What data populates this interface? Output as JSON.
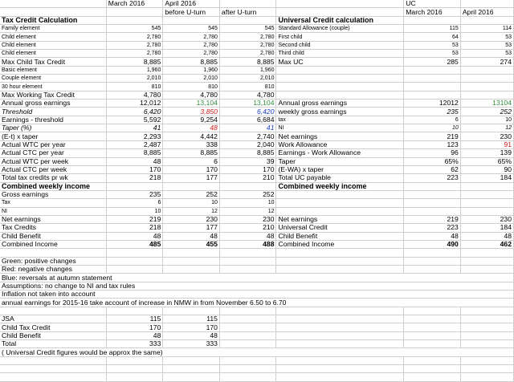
{
  "colors": {
    "green": "#2e8b3a",
    "red": "#d11d1d",
    "blue": "#1a3fc1",
    "grid": "#cfcfcf"
  },
  "rows": [
    {
      "c": [
        "",
        "March 2016",
        "April 2016",
        "",
        "",
        "",
        "UC",
        ""
      ]
    },
    {
      "c": [
        "",
        "",
        "before U-turn",
        "after U-turn",
        "",
        "",
        "March 2016",
        "April 2016"
      ]
    },
    {
      "cls": "hd",
      "c": [
        "Tax Credit Calculation",
        "",
        "",
        "",
        "",
        "Universal Credit calculation",
        "",
        ""
      ]
    },
    {
      "cls": "sm",
      "c": [
        "Family element",
        "545",
        "545",
        "545",
        "",
        "Standard Allowance (couple)",
        "115",
        "114"
      ]
    },
    {
      "cls": "sm",
      "c": [
        "Child element",
        "2,780",
        "2,780",
        "2,780",
        "",
        "First child",
        "64",
        "53"
      ]
    },
    {
      "cls": "sm",
      "c": [
        "Child element",
        "2,780",
        "2,780",
        "2,780",
        "",
        "Second child",
        "53",
        "53"
      ]
    },
    {
      "cls": "sm",
      "c": [
        "Child element",
        "2,780",
        "2,780",
        "2,780",
        "",
        "Third child",
        "53",
        "53"
      ]
    },
    {
      "c": [
        "Max Child Tax Credit",
        "8,885",
        "8,885",
        "8,885",
        "",
        "Max UC",
        "285",
        "274"
      ]
    },
    {
      "cls": "sm",
      "c": [
        "Basic element",
        "1,960",
        "1,960",
        "1,960",
        "",
        "",
        "",
        ""
      ]
    },
    {
      "cls": "sm",
      "c": [
        "Couple element",
        "2,010",
        "2,010",
        "2,010",
        "",
        "",
        "",
        ""
      ]
    },
    {
      "cls": "sm",
      "c": [
        "30 hour element",
        "810",
        "810",
        "810",
        "",
        "",
        "",
        ""
      ]
    },
    {
      "c": [
        "Max Working Tax Credit",
        "4,780",
        "4,780",
        "4,780",
        "",
        "",
        "",
        ""
      ]
    },
    {
      "c": [
        "Annual gross earnings",
        "12,012",
        "13,104",
        "13,104",
        "",
        "Annual gross earnings",
        "12012",
        "13104"
      ],
      "col": {
        "2": "green",
        "3": "green",
        "7": "green"
      }
    },
    {
      "c": [
        "Threshold",
        "6,420",
        "3,850",
        "6,420",
        "",
        "weekly gross earnings",
        "235",
        "252"
      ],
      "it": [
        0,
        1,
        2,
        3,
        6,
        7
      ],
      "col": {
        "2": "red",
        "3": "blue"
      }
    },
    {
      "c": [
        "Earnings - threshold",
        "5,592",
        "9,254",
        "6,684",
        "",
        "tax",
        "6",
        "10"
      ],
      "sm": [
        5,
        6,
        7
      ]
    },
    {
      "c": [
        "Taper (%)",
        "41",
        "48",
        "41",
        "",
        "NI",
        "10",
        "12"
      ],
      "it": [
        0,
        1,
        2,
        3,
        6,
        7
      ],
      "sm": [
        5,
        6,
        7
      ],
      "col": {
        "2": "red",
        "3": "blue"
      }
    },
    {
      "c": [
        "(E-t) x taper",
        "2,293",
        "4,442",
        "2,740",
        "",
        "Net earnings",
        "219",
        "230"
      ]
    },
    {
      "c": [
        "Actual WTC per year",
        "2,487",
        "338",
        "2,040",
        "",
        "Work Allowance",
        "123",
        "91"
      ],
      "col": {
        "7": "red"
      }
    },
    {
      "c": [
        "Actual CTC per year",
        "8,885",
        "8,885",
        "8,885",
        "",
        "Earnings - Work Allowance",
        "96",
        "139"
      ]
    },
    {
      "c": [
        "Actual WTC per week",
        "48",
        "6",
        "39",
        "",
        "Taper",
        "65%",
        "65%"
      ]
    },
    {
      "c": [
        "Actual CTC per week",
        "170",
        "170",
        "170",
        "",
        "(E-WA) x taper",
        "62",
        "90"
      ]
    },
    {
      "c": [
        "Total tax credits pr wk",
        "218",
        "177",
        "210",
        "",
        "Total UC payable",
        "223",
        "184"
      ]
    },
    {
      "cls": "hd",
      "c": [
        "Combined weekly income",
        "",
        "",
        "",
        "",
        "Combined weekly income",
        "",
        ""
      ]
    },
    {
      "c": [
        "Gross earnings",
        "235",
        "252",
        "252",
        "",
        "",
        "",
        ""
      ]
    },
    {
      "cls": "sm",
      "c": [
        "Tax",
        "6",
        "10",
        "10",
        "",
        "",
        "",
        ""
      ]
    },
    {
      "cls": "sm",
      "c": [
        "NI",
        "10",
        "12",
        "12",
        "",
        "",
        "",
        ""
      ]
    },
    {
      "c": [
        "Net earnings",
        "219",
        "230",
        "230",
        "",
        "Net earnings",
        "219",
        "230"
      ]
    },
    {
      "c": [
        "Tax Credits",
        "218",
        "177",
        "210",
        "",
        "Universal Credit",
        "223",
        "184"
      ]
    },
    {
      "c": [
        "Child Benefit",
        "48",
        "48",
        "48",
        "",
        "Child Benefit",
        "48",
        "48"
      ]
    },
    {
      "c": [
        "Combined Income",
        "485",
        "455",
        "488",
        "",
        "Combined Income",
        "490",
        "462"
      ],
      "b": [
        1,
        2,
        3,
        6,
        7
      ]
    },
    {
      "c": [
        "",
        "",
        "",
        "",
        "",
        "",
        "",
        ""
      ]
    },
    {
      "c": [
        "Green: positive changes",
        "",
        "",
        "",
        "",
        "",
        "",
        ""
      ]
    },
    {
      "c": [
        "Red: negative changes",
        "",
        "",
        "",
        "",
        "",
        "",
        ""
      ]
    },
    {
      "c": [
        "Blue: reversals at autumn statement",
        "",
        "",
        "",
        "",
        "",
        "",
        ""
      ]
    },
    {
      "c": [
        "Assumptions: no change to NI and tax rules",
        "",
        "",
        "",
        "",
        "",
        "",
        ""
      ]
    },
    {
      "c": [
        "Inflation not taken into account",
        "",
        "",
        "",
        "",
        "",
        "",
        ""
      ]
    },
    {
      "c": [
        "annual earnings for 2015-16 take account of increase in NMW in from November 6.50 to 6.70",
        "",
        "",
        "",
        "",
        "",
        "",
        ""
      ]
    },
    {
      "c": [
        "",
        "",
        "",
        "",
        "",
        "",
        "",
        ""
      ]
    },
    {
      "c": [
        "JSA",
        "115",
        "115",
        "",
        "",
        "",
        "",
        ""
      ]
    },
    {
      "c": [
        "Child Tax Credit",
        "170",
        "170",
        "",
        "",
        "",
        "",
        ""
      ]
    },
    {
      "c": [
        "Child Benefit",
        "48",
        "48",
        "",
        "",
        "",
        "",
        ""
      ]
    },
    {
      "c": [
        "Total",
        "333",
        "333",
        "",
        "",
        "",
        "",
        ""
      ]
    },
    {
      "c": [
        "( Universal Credit figures would be approx the same)",
        "",
        "",
        "",
        "",
        "",
        "",
        ""
      ]
    },
    {
      "c": [
        "",
        "",
        "",
        "",
        "",
        "",
        "",
        ""
      ]
    },
    {
      "c": [
        "",
        "",
        "",
        "",
        "",
        "",
        "",
        ""
      ]
    },
    {
      "c": [
        "",
        "",
        "",
        "",
        "",
        "",
        "",
        ""
      ]
    }
  ]
}
